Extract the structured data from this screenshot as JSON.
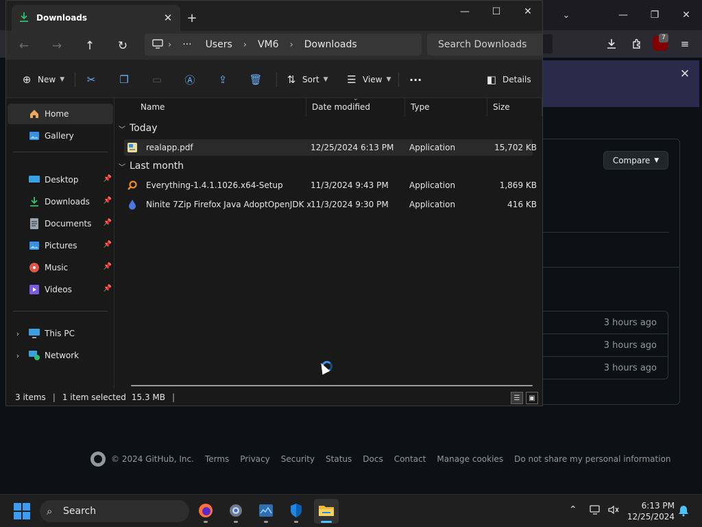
{
  "explorer": {
    "tab_title": "Downloads",
    "breadcrumb": [
      "Users",
      "VM6",
      "Downloads"
    ],
    "breadcrumb_overflow": "···",
    "search_placeholder": "Search Downloads",
    "command_bar": {
      "new_label": "New",
      "sort_label": "Sort",
      "view_label": "View",
      "more_label": "···",
      "details_label": "Details"
    },
    "nav_pane": {
      "home": "Home",
      "gallery": "Gallery",
      "quick_access": [
        {
          "label": "Desktop",
          "icon": "desktop-icon",
          "color": "#3aa0e0"
        },
        {
          "label": "Downloads",
          "icon": "download-icon",
          "color": "#2fbf71"
        },
        {
          "label": "Documents",
          "icon": "documents-icon",
          "color": "#9aa4b0"
        },
        {
          "label": "Pictures",
          "icon": "pictures-icon",
          "color": "#3b8fe0"
        },
        {
          "label": "Music",
          "icon": "music-icon",
          "color": "#e0584a"
        },
        {
          "label": "Videos",
          "icon": "videos-icon",
          "color": "#7b5ce0"
        }
      ],
      "this_pc": "This PC",
      "network": "Network"
    },
    "columns": {
      "name": "Name",
      "date_modified": "Date modified",
      "type": "Type",
      "size": "Size"
    },
    "groups": [
      {
        "label": "Today",
        "files": [
          {
            "name": "realapp.pdf",
            "date": "12/25/2024 6:13 PM",
            "type": "Application",
            "size": "15,702 KB",
            "icon": "pdf-app-icon",
            "selected": true
          }
        ]
      },
      {
        "label": "Last month",
        "files": [
          {
            "name": "Everything-1.4.1.1026.x64-Setup",
            "date": "11/3/2024 9:43 PM",
            "type": "Application",
            "size": "1,869 KB",
            "icon": "everything-icon",
            "selected": false
          },
          {
            "name": "Ninite 7Zip Firefox Java AdoptOpenJDK x...",
            "date": "11/3/2024 9:30 PM",
            "type": "Application",
            "size": "416 KB",
            "icon": "ninite-icon",
            "selected": false
          }
        ]
      }
    ],
    "status": {
      "items": "3 items",
      "selected": "1 item selected",
      "size": "15.3 MB"
    }
  },
  "browser": {
    "compare_label": "Compare",
    "ublock_count": "7",
    "commit_times": [
      "3 hours ago",
      "3 hours ago",
      "3 hours ago"
    ],
    "footer": {
      "copyright": "© 2024 GitHub, Inc.",
      "links": [
        "Terms",
        "Privacy",
        "Security",
        "Status",
        "Docs",
        "Contact",
        "Manage cookies",
        "Do not share my personal information"
      ]
    }
  },
  "taskbar": {
    "search_label": "Search",
    "time": "6:13 PM",
    "date": "12/25/2024"
  }
}
